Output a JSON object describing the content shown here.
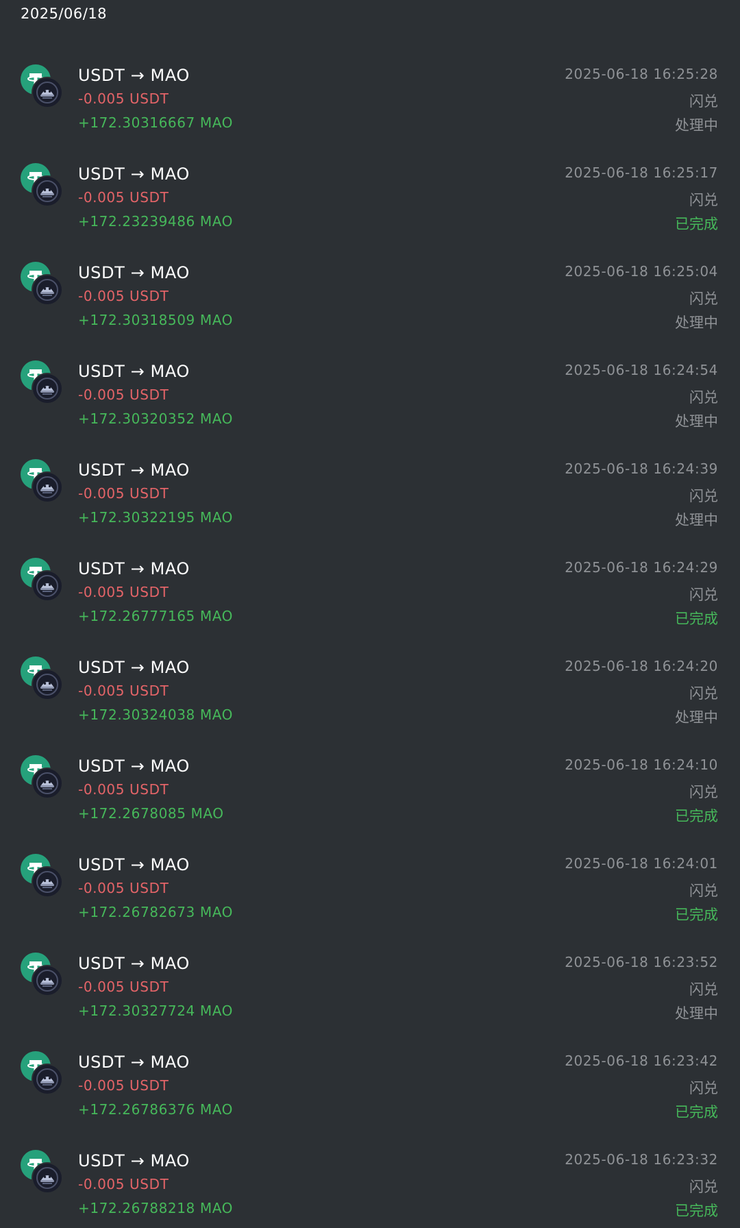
{
  "header": {
    "date": "2025/06/18"
  },
  "colors": {
    "background": "#2c3034",
    "negative": "#e46468",
    "positive": "#46b85a",
    "muted": "#8f9296",
    "usdt_brand": "#26a17b"
  },
  "icons": {
    "from_token": "usdt-icon",
    "to_token": "mao-icon"
  },
  "transactions": [
    {
      "title": "USDT → MAO",
      "amount_out": "-0.005 USDT",
      "amount_in": "+172.30316667 MAO",
      "timestamp": "2025-06-18 16:25:28",
      "type": "闪兑",
      "status": "处理中",
      "status_kind": "processing"
    },
    {
      "title": "USDT → MAO",
      "amount_out": "-0.005 USDT",
      "amount_in": "+172.23239486 MAO",
      "timestamp": "2025-06-18 16:25:17",
      "type": "闪兑",
      "status": "已完成",
      "status_kind": "done"
    },
    {
      "title": "USDT → MAO",
      "amount_out": "-0.005 USDT",
      "amount_in": "+172.30318509 MAO",
      "timestamp": "2025-06-18 16:25:04",
      "type": "闪兑",
      "status": "处理中",
      "status_kind": "processing"
    },
    {
      "title": "USDT → MAO",
      "amount_out": "-0.005 USDT",
      "amount_in": "+172.30320352 MAO",
      "timestamp": "2025-06-18 16:24:54",
      "type": "闪兑",
      "status": "处理中",
      "status_kind": "processing"
    },
    {
      "title": "USDT → MAO",
      "amount_out": "-0.005 USDT",
      "amount_in": "+172.30322195 MAO",
      "timestamp": "2025-06-18 16:24:39",
      "type": "闪兑",
      "status": "处理中",
      "status_kind": "processing"
    },
    {
      "title": "USDT → MAO",
      "amount_out": "-0.005 USDT",
      "amount_in": "+172.26777165 MAO",
      "timestamp": "2025-06-18 16:24:29",
      "type": "闪兑",
      "status": "已完成",
      "status_kind": "done"
    },
    {
      "title": "USDT → MAO",
      "amount_out": "-0.005 USDT",
      "amount_in": "+172.30324038 MAO",
      "timestamp": "2025-06-18 16:24:20",
      "type": "闪兑",
      "status": "处理中",
      "status_kind": "processing"
    },
    {
      "title": "USDT → MAO",
      "amount_out": "-0.005 USDT",
      "amount_in": "+172.2678085 MAO",
      "timestamp": "2025-06-18 16:24:10",
      "type": "闪兑",
      "status": "已完成",
      "status_kind": "done"
    },
    {
      "title": "USDT → MAO",
      "amount_out": "-0.005 USDT",
      "amount_in": "+172.26782673 MAO",
      "timestamp": "2025-06-18 16:24:01",
      "type": "闪兑",
      "status": "已完成",
      "status_kind": "done"
    },
    {
      "title": "USDT → MAO",
      "amount_out": "-0.005 USDT",
      "amount_in": "+172.30327724 MAO",
      "timestamp": "2025-06-18 16:23:52",
      "type": "闪兑",
      "status": "处理中",
      "status_kind": "processing"
    },
    {
      "title": "USDT → MAO",
      "amount_out": "-0.005 USDT",
      "amount_in": "+172.26786376 MAO",
      "timestamp": "2025-06-18 16:23:42",
      "type": "闪兑",
      "status": "已完成",
      "status_kind": "done"
    },
    {
      "title": "USDT → MAO",
      "amount_out": "-0.005 USDT",
      "amount_in": "+172.26788218 MAO",
      "timestamp": "2025-06-18 16:23:32",
      "type": "闪兑",
      "status": "已完成",
      "status_kind": "done"
    }
  ]
}
